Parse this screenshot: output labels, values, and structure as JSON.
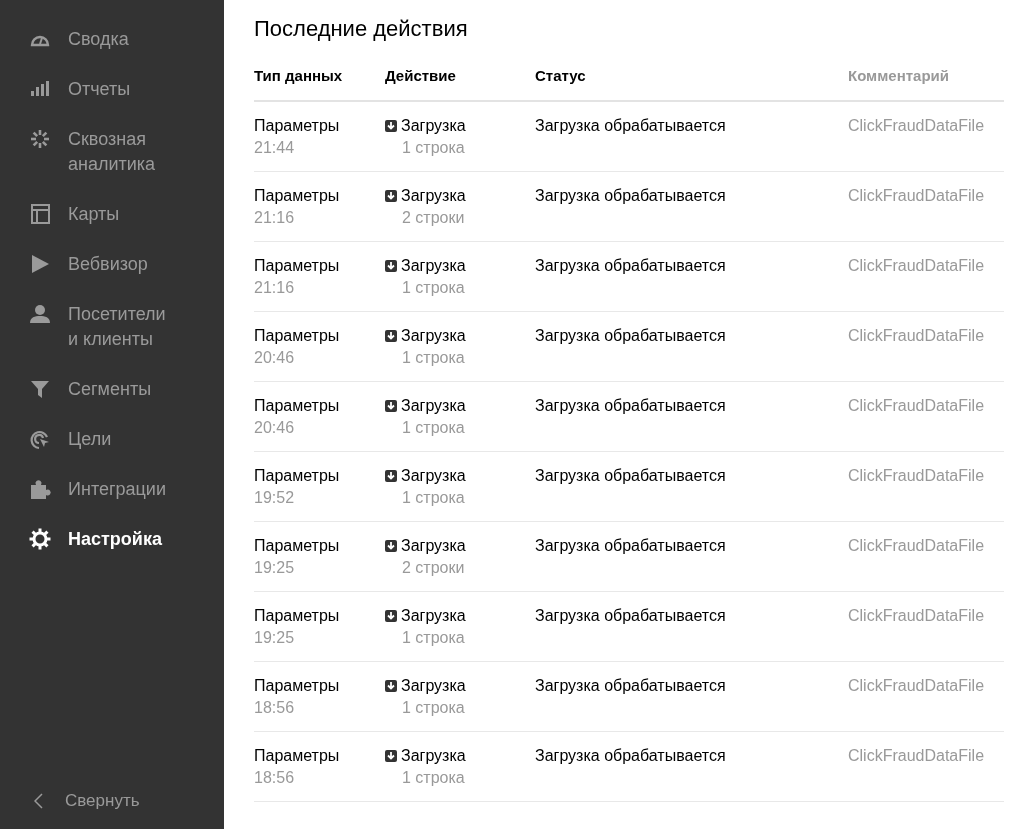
{
  "sidebar": {
    "items": [
      {
        "label": "Сводка",
        "selected": false
      },
      {
        "label": "Отчеты",
        "selected": false
      },
      {
        "label": "Сквозная аналитика",
        "selected": false
      },
      {
        "label": "Карты",
        "selected": false
      },
      {
        "label": "Вебвизор",
        "selected": false
      },
      {
        "label": "Посетители и клиенты",
        "selected": false
      },
      {
        "label": "Сегменты",
        "selected": false
      },
      {
        "label": "Цели",
        "selected": false
      },
      {
        "label": "Интеграции",
        "selected": false
      },
      {
        "label": "Настройка",
        "selected": true
      }
    ],
    "collapse": "Свернуть"
  },
  "title": "Последние действия",
  "table": {
    "columns": [
      {
        "label": "Тип данных",
        "muted": false
      },
      {
        "label": "Действие",
        "muted": false
      },
      {
        "label": "Статус",
        "muted": false
      },
      {
        "label": "Комментарий",
        "muted": true
      }
    ],
    "rows": [
      {
        "type": "Параметры",
        "time": "21:44",
        "action": "Загрузка",
        "count": "1 строка",
        "status": "Загрузка обрабатывается",
        "comment": "ClickFraudDataFile"
      },
      {
        "type": "Параметры",
        "time": "21:16",
        "action": "Загрузка",
        "count": "2 строки",
        "status": "Загрузка обрабатывается",
        "comment": "ClickFraudDataFile"
      },
      {
        "type": "Параметры",
        "time": "21:16",
        "action": "Загрузка",
        "count": "1 строка",
        "status": "Загрузка обрабатывается",
        "comment": "ClickFraudDataFile"
      },
      {
        "type": "Параметры",
        "time": "20:46",
        "action": "Загрузка",
        "count": "1 строка",
        "status": "Загрузка обрабатывается",
        "comment": "ClickFraudDataFile"
      },
      {
        "type": "Параметры",
        "time": "20:46",
        "action": "Загрузка",
        "count": "1 строка",
        "status": "Загрузка обрабатывается",
        "comment": "ClickFraudDataFile"
      },
      {
        "type": "Параметры",
        "time": "19:52",
        "action": "Загрузка",
        "count": "1 строка",
        "status": "Загрузка обрабатывается",
        "comment": "ClickFraudDataFile"
      },
      {
        "type": "Параметры",
        "time": "19:25",
        "action": "Загрузка",
        "count": "2 строки",
        "status": "Загрузка обрабатывается",
        "comment": "ClickFraudDataFile"
      },
      {
        "type": "Параметры",
        "time": "19:25",
        "action": "Загрузка",
        "count": "1 строка",
        "status": "Загрузка обрабатывается",
        "comment": "ClickFraudDataFile"
      },
      {
        "type": "Параметры",
        "time": "18:56",
        "action": "Загрузка",
        "count": "1 строка",
        "status": "Загрузка обрабатывается",
        "comment": "ClickFraudDataFile"
      },
      {
        "type": "Параметры",
        "time": "18:56",
        "action": "Загрузка",
        "count": "1 строка",
        "status": "Загрузка обрабатывается",
        "comment": "ClickFraudDataFile"
      }
    ]
  }
}
